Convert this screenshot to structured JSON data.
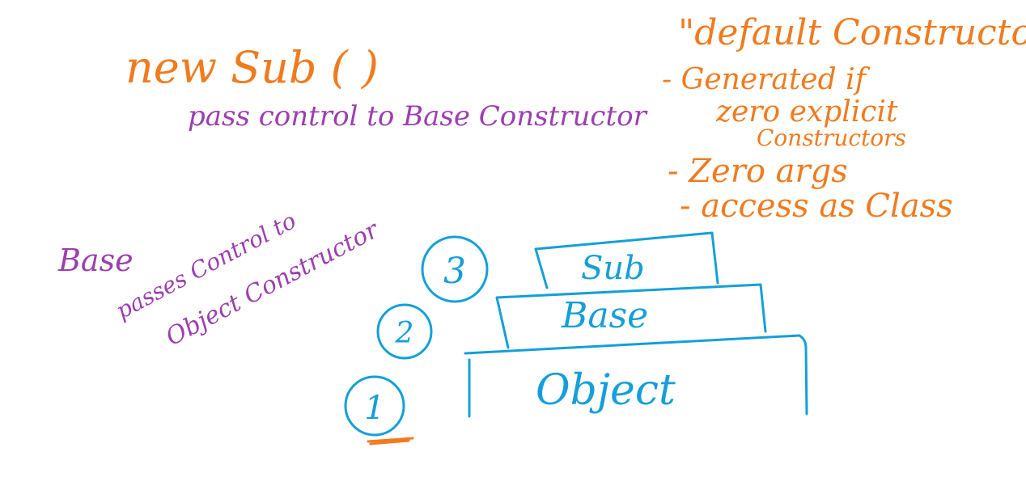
{
  "colors": {
    "orange": "#f07b1f",
    "purple": "#9b3fae",
    "blue": "#159fd8"
  },
  "title": {
    "call": "new Sub ( )",
    "subtitle": "pass control to Base Constructor"
  },
  "notes": {
    "heading": "\"default Constructor\"",
    "item1_line1": "- Generated if",
    "item1_line2": "zero explicit",
    "item1_line3": "Constructors",
    "item2": "- Zero args",
    "item3": "- access as Class"
  },
  "side_note": {
    "line1": "Base",
    "line2": "passes Control to",
    "line3": "Object Constructor"
  },
  "stack": {
    "top": "Sub",
    "middle": "Base",
    "bottom": "Object"
  },
  "steps": {
    "top": "3",
    "middle": "2",
    "bottom": "1"
  }
}
